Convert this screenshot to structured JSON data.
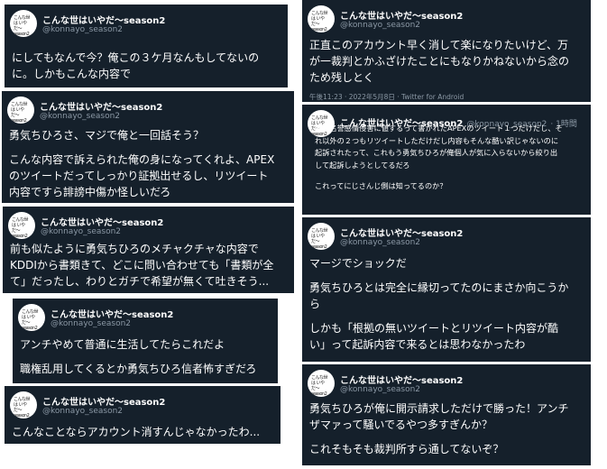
{
  "user": {
    "name": "こんな世はいやだ〜season2",
    "handle": "@konnayo_season2",
    "avatar_text": "こんな世は いやだ〜 season2"
  },
  "cards": [
    {
      "lines": [
        "にしてもなんで今？俺この３ケ月なんもしてないの",
        "に。しかもこんな内容で"
      ]
    },
    {
      "lines": [
        "勇気ちひろさ、マジで俺と一回話そう？",
        "",
        "こんな内容で訴えられた俺の身になってくれよ、APEX",
        "のツイートだってしっかり証拠出せるし、リツイート",
        "内容ですら誹謗中傷か怪しいだろ"
      ]
    },
    {
      "lines": [
        "前も似たように勇気ちひろのメチャクチャな内容で",
        "KDDIから書類きて、どこに問い合わせても「書類が全",
        "て」だったし、わりとガチで希望が無くて吐きそう..."
      ]
    },
    {
      "lines": [
        "アンチやめて普通に生活してたらこれだよ",
        "",
        "職権乱用してくるとか勇気ちひろ信者怖すぎだろ"
      ]
    },
    {
      "lines": [
        "こんなことならアカウント消すんじゃなかったわ..."
      ]
    },
    {
      "lines": [
        "正直このアカウント早く消して楽になりたいけど、万",
        "が一裁判とかふざけたことにもなりかねないから念の",
        "ため残しとく"
      ],
      "meta": "午後11:23 · 2022年5月8日 · Twitter for Android"
    },
    {
      "time": "· 1時間",
      "lines": [
        "俺の名誉感情侵害に値するって書かれたAPEXのツイート１つだけだし、そ",
        "れ以外の２つもリツイートしただけだし内容もそんな酷い訳じゃないのに",
        "起訴されたって、これもう勇気ちひろが俺個人が気に入らないから絞り出",
        "して起訴しようとしてるだろ",
        "",
        "これってにじさんじ側は知ってるのか？"
      ]
    },
    {
      "lines": [
        "マージでショックだ",
        "",
        "勇気ちひろとは完全に縁切ってたのにまさか向こうか",
        "ら",
        "",
        "しかも「根拠の無いツイートとリツイート内容が酷",
        "い」って起訴内容で来るとは思わなかったわ"
      ]
    },
    {
      "lines": [
        "勇気ちひろが俺に開示請求しただけで勝った！アンチ",
        "ザマァって騒いでるやつ多すぎんか？",
        "",
        "これそもそも裁判所すら通してないぞ？"
      ]
    }
  ]
}
